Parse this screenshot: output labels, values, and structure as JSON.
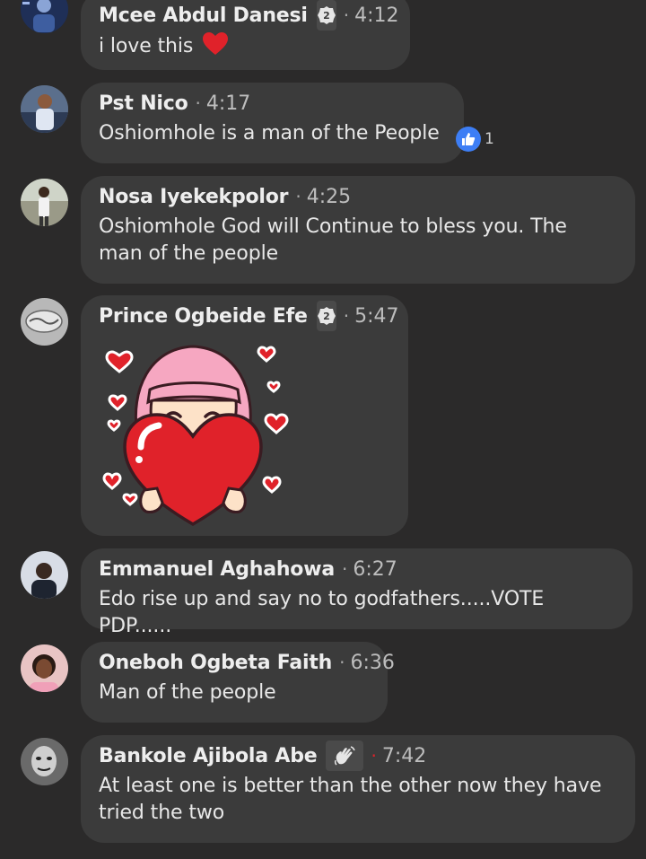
{
  "comments": [
    {
      "name": "Mcee Abdul Danesi",
      "badge": "2",
      "time": "4:12",
      "text": "i love this",
      "emoji": "heart-emoji"
    },
    {
      "name": "Pst Nico",
      "time": "4:17",
      "text": "Oshiomhole is a man of the People",
      "reaction_count": "1"
    },
    {
      "name": "Nosa Iyekekpolor",
      "time": "4:25",
      "text_line1": "Oshiomhole God will Continue to bless you. The",
      "text_line2": "man of the people"
    },
    {
      "name": "Prince Ogbeide Efe",
      "badge": "2",
      "time": "5:47",
      "sticker": "girl-hugging-heart-sticker"
    },
    {
      "name": "Emmanuel Aghahowa",
      "time": "6:27",
      "text": "Edo rise up and say no to godfathers.....VOTE PDP......"
    },
    {
      "name": "Oneboh Ogbeta Faith",
      "time": "6:36",
      "text": "Man of the people"
    },
    {
      "name": "Bankole Ajibola Abe",
      "badge_icon": "waving-hand-icon",
      "time": "7:42",
      "text_line1": "At least one is better than the other now they have",
      "text_line2": "tried the two"
    }
  ],
  "separator": "·",
  "colors": {
    "background": "#2b2a2a",
    "bubble": "#3b3b3b",
    "like_blue": "#3d7ef5",
    "heart_red": "#e0222a",
    "badge_bg": "#4a4a4a"
  }
}
